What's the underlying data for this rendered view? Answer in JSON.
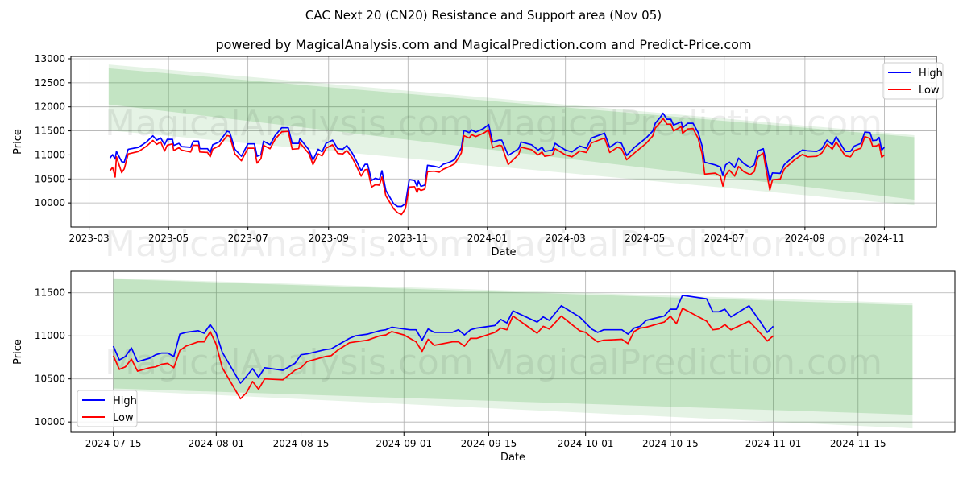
{
  "header": {
    "title": "CAC Next 20 (CN20) Resistance and Support area (Nov 05)",
    "subtitle": "powered by MagicalAnalysis.com and MagicalPrediction.com and Predict-Price.com"
  },
  "watermarks": [
    "MagicalAnalysis.com",
    "MagicalPrediction.com"
  ],
  "colors": {
    "High": "#0000ff",
    "Low": "#ff0000",
    "band": "#2ca02c",
    "grid": "#b0b0b0"
  },
  "chart_data": [
    {
      "type": "line",
      "xlabel": "Date",
      "ylabel": "Price",
      "xlim": [
        "2023-02-15",
        "2024-12-11"
      ],
      "ylim": [
        9500,
        13050
      ],
      "grid": true,
      "legend": "upper right",
      "x_ticks": [
        "2023-03",
        "2023-05",
        "2023-07",
        "2023-09",
        "2023-11",
        "2024-01",
        "2024-03",
        "2024-05",
        "2024-07",
        "2024-09",
        "2024-11"
      ],
      "y_ticks": [
        "10000",
        "10500",
        "11000",
        "11500",
        "12000",
        "12500",
        "13000"
      ],
      "bands": [
        {
          "kind": "outer",
          "x": [
            "2023-03-16",
            "2024-11-24"
          ],
          "upper": [
            12880,
            11410
          ],
          "lower": [
            11510,
            9950
          ]
        },
        {
          "kind": "inner",
          "x": [
            "2023-03-16",
            "2024-11-24"
          ],
          "upper": [
            12800,
            11370
          ],
          "lower": [
            12050,
            10070
          ]
        }
      ],
      "dates": [
        "2023-03-17",
        "2023-03-19",
        "2023-03-21",
        "2023-03-22",
        "2023-03-26",
        "2023-03-28",
        "2023-03-31",
        "2023-04-08",
        "2023-04-14",
        "2023-04-19",
        "2023-04-22",
        "2023-04-25",
        "2023-04-28",
        "2023-04-30",
        "2023-05-04",
        "2023-05-05",
        "2023-05-09",
        "2023-05-11",
        "2023-05-18",
        "2023-05-20",
        "2023-05-24",
        "2023-05-25",
        "2023-05-31",
        "2023-06-02",
        "2023-06-04",
        "2023-06-09",
        "2023-06-15",
        "2023-06-17",
        "2023-06-21",
        "2023-06-26",
        "2023-07-01",
        "2023-07-06",
        "2023-07-08",
        "2023-07-11",
        "2023-07-13",
        "2023-07-18",
        "2023-07-22",
        "2023-07-27",
        "2023-08-01",
        "2023-08-04",
        "2023-08-09",
        "2023-08-10",
        "2023-08-17",
        "2023-08-20",
        "2023-08-24",
        "2023-08-27",
        "2023-08-30",
        "2023-09-04",
        "2023-09-08",
        "2023-09-12",
        "2023-09-15",
        "2023-09-19",
        "2023-09-22",
        "2023-09-26",
        "2023-09-29",
        "2023-10-01",
        "2023-10-04",
        "2023-10-07",
        "2023-10-10",
        "2023-10-12",
        "2023-10-15",
        "2023-10-21",
        "2023-10-24",
        "2023-10-27",
        "2023-10-30",
        "2023-11-02",
        "2023-11-06",
        "2023-11-08",
        "2023-11-09",
        "2023-11-11",
        "2023-11-14",
        "2023-11-16",
        "2023-11-21",
        "2023-11-25",
        "2023-11-28",
        "2023-12-03",
        "2023-12-07",
        "2023-12-10",
        "2023-12-12",
        "2023-12-14",
        "2023-12-18",
        "2023-12-20",
        "2023-12-23",
        "2023-12-29",
        "2024-01-02",
        "2024-01-05",
        "2024-01-10",
        "2024-01-12",
        "2024-01-17",
        "2024-01-25",
        "2024-01-27",
        "2024-02-04",
        "2024-02-09",
        "2024-02-12",
        "2024-02-14",
        "2024-02-20",
        "2024-02-22",
        "2024-03-01",
        "2024-03-06",
        "2024-03-12",
        "2024-03-17",
        "2024-03-21",
        "2024-03-31",
        "2024-04-04",
        "2024-04-10",
        "2024-04-13",
        "2024-04-17",
        "2024-04-23",
        "2024-05-02",
        "2024-05-07",
        "2024-05-09",
        "2024-05-13",
        "2024-05-15",
        "2024-05-18",
        "2024-05-21",
        "2024-05-23",
        "2024-05-29",
        "2024-05-30",
        "2024-06-03",
        "2024-06-07",
        "2024-06-11",
        "2024-06-14",
        "2024-06-16",
        "2024-06-24",
        "2024-06-28",
        "2024-06-30",
        "2024-07-02",
        "2024-07-05",
        "2024-07-09",
        "2024-07-12",
        "2024-07-16",
        "2024-07-21",
        "2024-07-24",
        "2024-07-27",
        "2024-07-31",
        "2024-08-02",
        "2024-08-05",
        "2024-08-07",
        "2024-08-13",
        "2024-08-16",
        "2024-08-24",
        "2024-08-30",
        "2024-09-03",
        "2024-09-10",
        "2024-09-14",
        "2024-09-18",
        "2024-09-22",
        "2024-09-25",
        "2024-10-02",
        "2024-10-06",
        "2024-10-09",
        "2024-10-14",
        "2024-10-17",
        "2024-10-21",
        "2024-10-23",
        "2024-10-26",
        "2024-10-28",
        "2024-10-30",
        "2024-11-01"
      ],
      "series": [
        {
          "name": "High",
          "values": [
            10933,
            11006,
            10916,
            11073,
            10860,
            10849,
            11117,
            11157,
            11268,
            11397,
            11307,
            11352,
            11212,
            11324,
            11324,
            11196,
            11240,
            11173,
            11157,
            11285,
            11285,
            11129,
            11129,
            11045,
            11212,
            11268,
            11492,
            11475,
            11117,
            10972,
            11229,
            11229,
            10972,
            11006,
            11285,
            11212,
            11408,
            11564,
            11564,
            11240,
            11240,
            11341,
            11101,
            10894,
            11117,
            11062,
            11240,
            11307,
            11129,
            11117,
            11196,
            11045,
            10894,
            10670,
            10805,
            10805,
            10469,
            10514,
            10486,
            10670,
            10263,
            9983,
            9927,
            9927,
            9983,
            10486,
            10469,
            10346,
            10458,
            10346,
            10374,
            10782,
            10765,
            10737,
            10805,
            10849,
            10905,
            11062,
            11140,
            11509,
            11464,
            11520,
            11475,
            11548,
            11631,
            11268,
            11307,
            11307,
            10989,
            11129,
            11268,
            11212,
            11101,
            11157,
            11073,
            11101,
            11240,
            11101,
            11062,
            11184,
            11140,
            11352,
            11453,
            11157,
            11268,
            11240,
            10989,
            11157,
            11352,
            11492,
            11659,
            11788,
            11866,
            11743,
            11743,
            11620,
            11687,
            11564,
            11659,
            11659,
            11464,
            11184,
            10849,
            10793,
            10749,
            10570,
            10793,
            10849,
            10737,
            10933,
            10821,
            10737,
            10793,
            11084,
            11129,
            10877,
            10458,
            10626,
            10615,
            10793,
            10989,
            11101,
            11084,
            11073,
            11129,
            11307,
            11212,
            11380,
            11073,
            11073,
            11184,
            11240,
            11475,
            11464,
            11296,
            11307,
            11363,
            11101,
            11157
          ]
        },
        {
          "name": "Low",
          "values": [
            10670,
            10740,
            10540,
            10960,
            10630,
            10710,
            11020,
            11070,
            11180,
            11300,
            11220,
            11270,
            11080,
            11200,
            11230,
            11090,
            11150,
            11100,
            11060,
            11200,
            11200,
            11060,
            11050,
            10960,
            11120,
            11190,
            11400,
            11390,
            11020,
            10880,
            11140,
            11140,
            10830,
            10920,
            11200,
            11130,
            11330,
            11480,
            11490,
            11120,
            11130,
            11250,
            11020,
            10800,
            11020,
            10980,
            11140,
            11210,
            11030,
            11020,
            11090,
            10950,
            10790,
            10560,
            10690,
            10700,
            10330,
            10380,
            10370,
            10540,
            10150,
            9880,
            9800,
            9760,
            9880,
            10330,
            10340,
            10220,
            10300,
            10260,
            10290,
            10650,
            10660,
            10640,
            10700,
            10760,
            10820,
            10950,
            11040,
            11400,
            11350,
            11420,
            11380,
            11450,
            11520,
            11150,
            11200,
            11190,
            10800,
            11010,
            11160,
            11110,
            11000,
            11060,
            10970,
            11000,
            11130,
            11000,
            10960,
            11080,
            11050,
            11250,
            11350,
            11050,
            11160,
            11130,
            10900,
            11040,
            11240,
            11390,
            11560,
            11680,
            11760,
            11640,
            11640,
            11500,
            11590,
            11450,
            11540,
            11550,
            11340,
            11020,
            10600,
            10620,
            10560,
            10350,
            10580,
            10680,
            10560,
            10760,
            10650,
            10590,
            10650,
            10960,
            11040,
            10720,
            10270,
            10480,
            10500,
            10700,
            10900,
            11010,
            10960,
            10970,
            11040,
            11220,
            11120,
            11270,
            10980,
            10960,
            11090,
            11140,
            11380,
            11340,
            11180,
            11190,
            11220,
            10950,
            11000
          ]
        }
      ]
    },
    {
      "type": "line",
      "xlabel": "Date",
      "ylabel": "Price",
      "xlim": [
        "2024-07-08",
        "2024-12-01"
      ],
      "ylim": [
        9880,
        11750
      ],
      "grid": true,
      "legend": "lower left",
      "x_ticks": [
        "2024-07-15",
        "2024-08-01",
        "2024-08-15",
        "2024-09-01",
        "2024-09-15",
        "2024-10-01",
        "2024-10-15",
        "2024-11-01",
        "2024-11-15"
      ],
      "y_ticks": [
        "10000",
        "10500",
        "11000",
        "11500"
      ],
      "bands": [
        {
          "kind": "outer",
          "x": [
            "2024-07-15",
            "2024-11-24"
          ],
          "upper": [
            11670,
            11380
          ],
          "lower": [
            10370,
            9925
          ]
        },
        {
          "kind": "inner",
          "x": [
            "2024-07-15",
            "2024-11-24"
          ],
          "upper": [
            11660,
            11355
          ],
          "lower": [
            10390,
            10085
          ]
        }
      ],
      "dates": [
        "2024-07-15",
        "2024-07-16",
        "2024-07-17",
        "2024-07-18",
        "2024-07-19",
        "2024-07-21",
        "2024-07-22",
        "2024-07-23",
        "2024-07-24",
        "2024-07-25",
        "2024-07-26",
        "2024-07-27",
        "2024-07-29",
        "2024-07-30",
        "2024-07-31",
        "2024-08-01",
        "2024-08-02",
        "2024-08-05",
        "2024-08-06",
        "2024-08-07",
        "2024-08-08",
        "2024-08-09",
        "2024-08-12",
        "2024-08-14",
        "2024-08-15",
        "2024-08-16",
        "2024-08-19",
        "2024-08-20",
        "2024-08-21",
        "2024-08-23",
        "2024-08-24",
        "2024-08-26",
        "2024-08-28",
        "2024-08-29",
        "2024-08-30",
        "2024-09-01",
        "2024-09-02",
        "2024-09-03",
        "2024-09-04",
        "2024-09-05",
        "2024-09-06",
        "2024-09-09",
        "2024-09-10",
        "2024-09-11",
        "2024-09-12",
        "2024-09-13",
        "2024-09-16",
        "2024-09-17",
        "2024-09-18",
        "2024-09-19",
        "2024-09-23",
        "2024-09-24",
        "2024-09-25",
        "2024-09-27",
        "2024-09-30",
        "2024-10-01",
        "2024-10-02",
        "2024-10-03",
        "2024-10-04",
        "2024-10-07",
        "2024-10-08",
        "2024-10-09",
        "2024-10-10",
        "2024-10-11",
        "2024-10-14",
        "2024-10-15",
        "2024-10-16",
        "2024-10-17",
        "2024-10-21",
        "2024-10-22",
        "2024-10-23",
        "2024-10-24",
        "2024-10-25",
        "2024-10-28",
        "2024-10-30",
        "2024-10-31",
        "2024-11-01"
      ],
      "series": [
        {
          "name": "High",
          "values": [
            10880,
            10720,
            10760,
            10860,
            10700,
            10740,
            10780,
            10800,
            10800,
            10760,
            11020,
            11040,
            11060,
            11030,
            11130,
            11030,
            10810,
            10450,
            10530,
            10620,
            10520,
            10630,
            10600,
            10680,
            10780,
            10790,
            10840,
            10850,
            10890,
            10970,
            11000,
            11020,
            11060,
            11070,
            11100,
            11080,
            11070,
            11070,
            10950,
            11080,
            11040,
            11040,
            11070,
            11010,
            11070,
            11090,
            11120,
            11190,
            11150,
            11290,
            11160,
            11220,
            11180,
            11350,
            11220,
            11150,
            11080,
            11040,
            11070,
            11070,
            11020,
            11090,
            11110,
            11180,
            11230,
            11310,
            11310,
            11470,
            11430,
            11280,
            11280,
            11310,
            11220,
            11350,
            11150,
            11040,
            11110
          ]
        },
        {
          "name": "Low",
          "values": [
            10770,
            10610,
            10640,
            10730,
            10590,
            10630,
            10640,
            10670,
            10680,
            10630,
            10830,
            10880,
            10930,
            10930,
            11050,
            10900,
            10630,
            10270,
            10340,
            10470,
            10380,
            10500,
            10490,
            10600,
            10630,
            10700,
            10760,
            10770,
            10830,
            10920,
            10930,
            10950,
            11000,
            11010,
            11050,
            11010,
            10970,
            10930,
            10820,
            10960,
            10890,
            10930,
            10930,
            10880,
            10970,
            10970,
            11040,
            11090,
            11070,
            11230,
            11030,
            11110,
            11080,
            11230,
            11060,
            11040,
            10980,
            10930,
            10950,
            10960,
            10910,
            11050,
            11090,
            11100,
            11160,
            11230,
            11140,
            11320,
            11170,
            11070,
            11080,
            11130,
            11070,
            11170,
            11020,
            10940,
            11000
          ]
        }
      ]
    }
  ]
}
